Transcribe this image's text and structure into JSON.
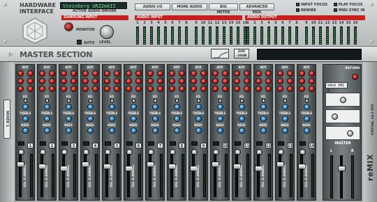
{
  "hardware": {
    "title_line1": "HARDWARE",
    "title_line2": "INTERFACE",
    "driver_name": "Steinberg UR22mkII",
    "driver_label": "ACTIVE AUDIO DRIVER",
    "sampling_input_label": "SAMPLING INPUT",
    "monitor_label": "MONITOR",
    "auto_label": "AUTO",
    "level_label": "LEVEL",
    "buttons": [
      "AUDIO I/O",
      "MORE AUDIO",
      "BIG METER",
      "ADVANCED MIDI"
    ],
    "flags": {
      "input_focus": "INPUT FOCUS",
      "play_focus": "PLAY FOCUS",
      "rewire": "REWIRE",
      "midi_sync_in": "MIDI SYNC IN"
    },
    "audio_input_label": "AUDIO INPUT",
    "audio_output_label": "AUDIO OUTPUT",
    "input_channels": [
      "1",
      "2",
      "3",
      "4",
      "5",
      "6",
      "7",
      "8",
      "9",
      "10",
      "11",
      "12",
      "13",
      "14",
      "15",
      "16"
    ],
    "output_channels": [
      "1",
      "2",
      "3",
      "4",
      "5",
      "6",
      "7",
      "8",
      "9",
      "10",
      "11",
      "12",
      "13",
      "14",
      "15",
      "16"
    ]
  },
  "master_section": {
    "title": "MASTER SECTION",
    "dim_label_1": "DIM",
    "dim_label_2": "-20dB"
  },
  "mixer": {
    "tab_label": "MIXER 1",
    "brand": "reMIX",
    "sub_brand": "VIRTUAL 14:2 MIX",
    "section_labels": {
      "aux": "AUX",
      "eq": "EQ",
      "treble": "TREBLE",
      "bass": "BASS",
      "return": "RETURN",
      "master": "MASTER",
      "left": "L",
      "right": "R"
    },
    "channel_numbers": [
      "1",
      "2",
      "3",
      "4",
      "5",
      "6",
      "7",
      "8",
      "9",
      "10",
      "11",
      "12",
      "13",
      "14"
    ],
    "channel_names": [
      "SSL E-ANNEL",
      "SSL E-ANNEL",
      "SSL E-ANNEL",
      "SSL E-ANNEL",
      "SSL E-ANNEL",
      "SSL E-ANNEL",
      "SSL E-ANNEL",
      "SSL E-ANNEL",
      "SSL E-ANNEL",
      "SSL E-ANNEL",
      "SSL E-ANNEL",
      "SSL E-ANNEL",
      "SSL E-ANNEL",
      "SSL E-ANNEL"
    ],
    "master_display": "VALR XMI 1"
  }
}
